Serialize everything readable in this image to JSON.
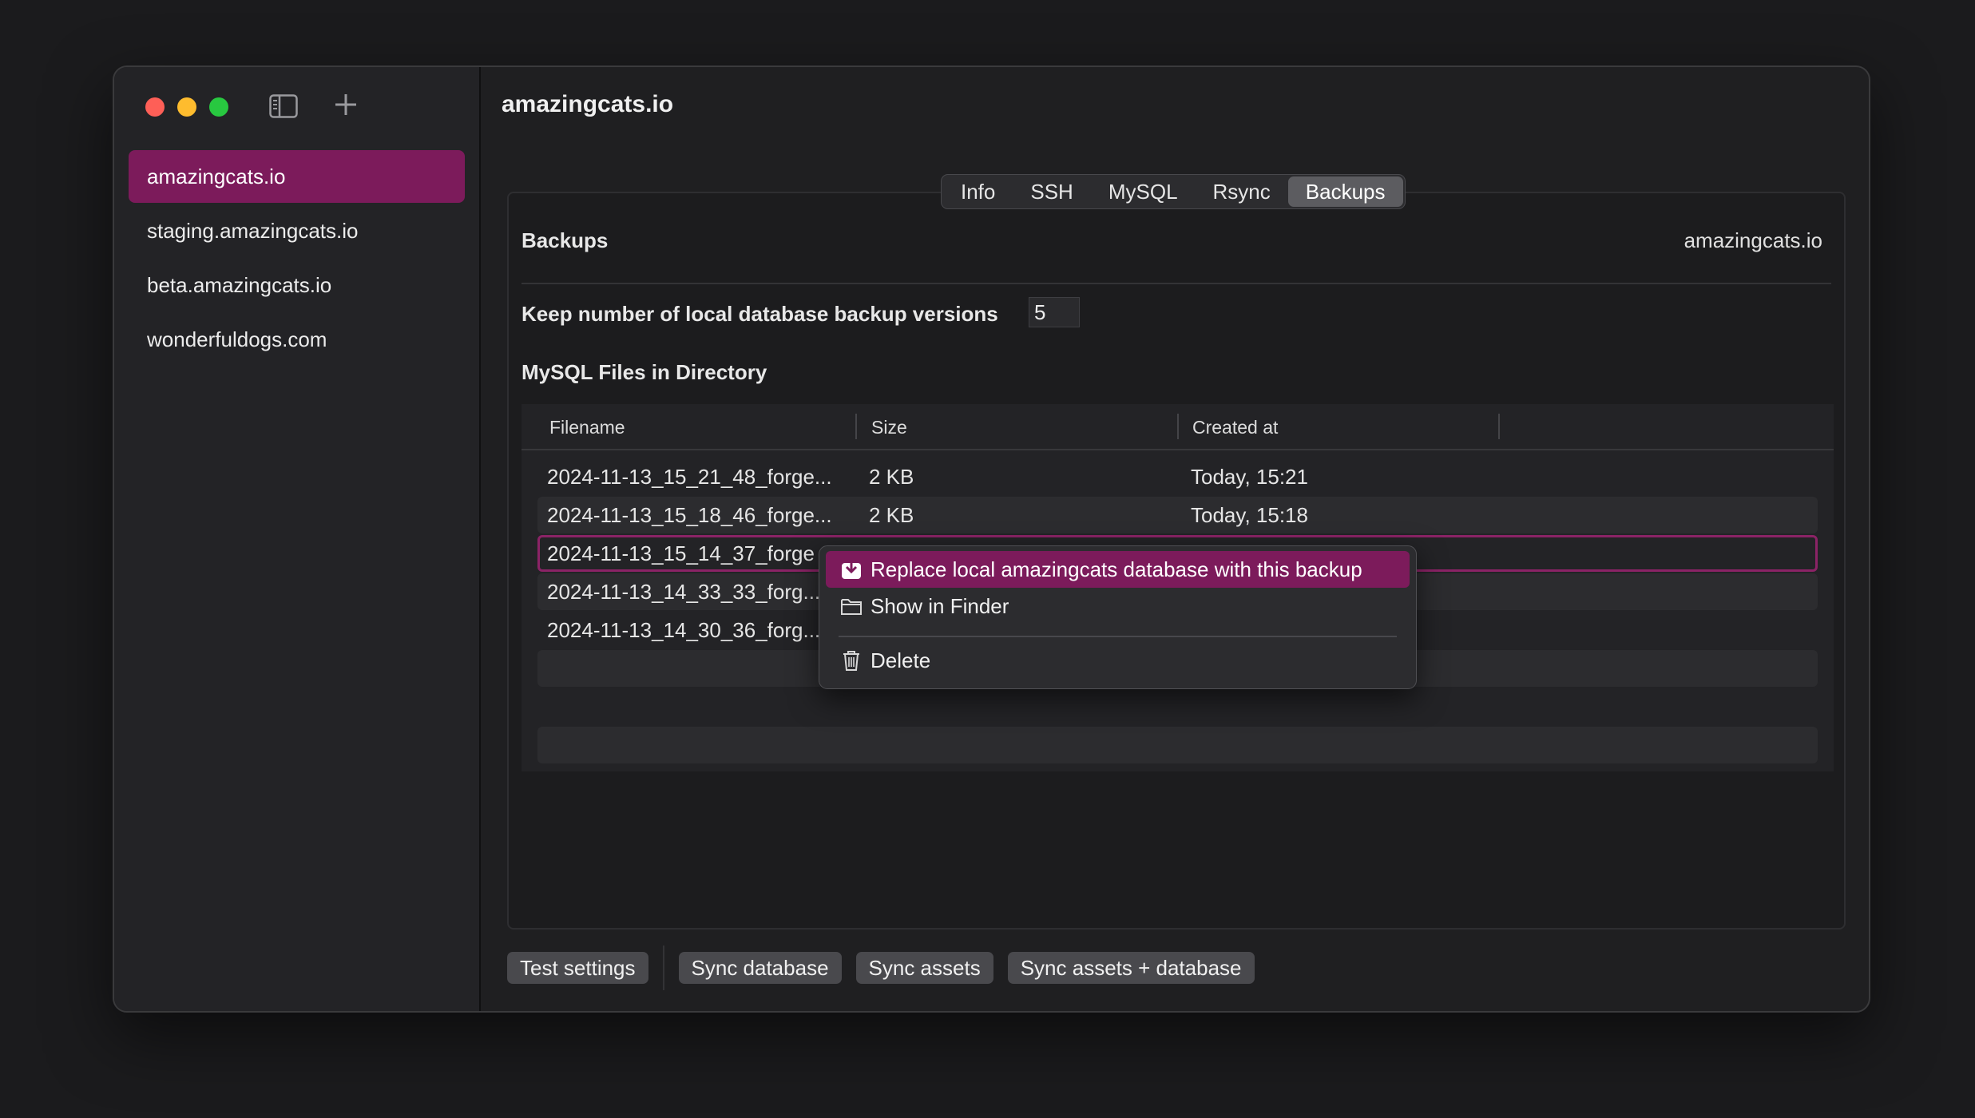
{
  "sidebar": {
    "items": [
      {
        "label": "amazingcats.io",
        "active": true
      },
      {
        "label": "staging.amazingcats.io"
      },
      {
        "label": "beta.amazingcats.io"
      },
      {
        "label": "wonderfuldogs.com"
      }
    ],
    "toggle_icon": "sidebar-toggle-icon",
    "add_icon": "plus-icon"
  },
  "header": {
    "title": "amazingcats.io",
    "key_icon": "key-icon",
    "settings_icon": "gear-icon"
  },
  "tabs": [
    {
      "label": "Info"
    },
    {
      "label": "SSH"
    },
    {
      "label": "MySQL"
    },
    {
      "label": "Rsync"
    },
    {
      "label": "Backups",
      "active": true
    }
  ],
  "backups": {
    "title": "Backups",
    "site": "amazingcats.io",
    "keep_label": "Keep number of local database backup versions",
    "keep_value": "5",
    "files_title": "MySQL Files in Directory",
    "columns": {
      "filename": "Filename",
      "size": "Size",
      "created": "Created at"
    },
    "rows": [
      {
        "filename": "2024-11-13_15_21_48_forge...",
        "size": "2 KB",
        "created": "Today, 15:21"
      },
      {
        "filename": "2024-11-13_15_18_46_forge...",
        "size": "2 KB",
        "created": "Today, 15:18"
      },
      {
        "filename": "2024-11-13_15_14_37_forge",
        "size": "",
        "created": "",
        "selected": true
      },
      {
        "filename": "2024-11-13_14_33_33_forg...",
        "size": "",
        "created": ""
      },
      {
        "filename": "2024-11-13_14_30_36_forg...",
        "size": "",
        "created": ""
      }
    ]
  },
  "context_menu": {
    "items": [
      {
        "label": "Replace local amazingcats database with this backup",
        "icon": "download-database-icon"
      },
      {
        "label": "Show in Finder",
        "icon": "folder-icon"
      },
      {
        "label": "Delete",
        "icon": "trash-icon"
      }
    ],
    "highlight_color": "#7c1b5b"
  },
  "toolbar": {
    "test_settings": "Test settings",
    "sync_database": "Sync database",
    "sync_assets": "Sync assets",
    "sync_both": "Sync assets + database"
  },
  "colors": {
    "accent": "#7c1b5b",
    "window_bg": "#1f1f21",
    "sidebar_bg": "#232326"
  }
}
